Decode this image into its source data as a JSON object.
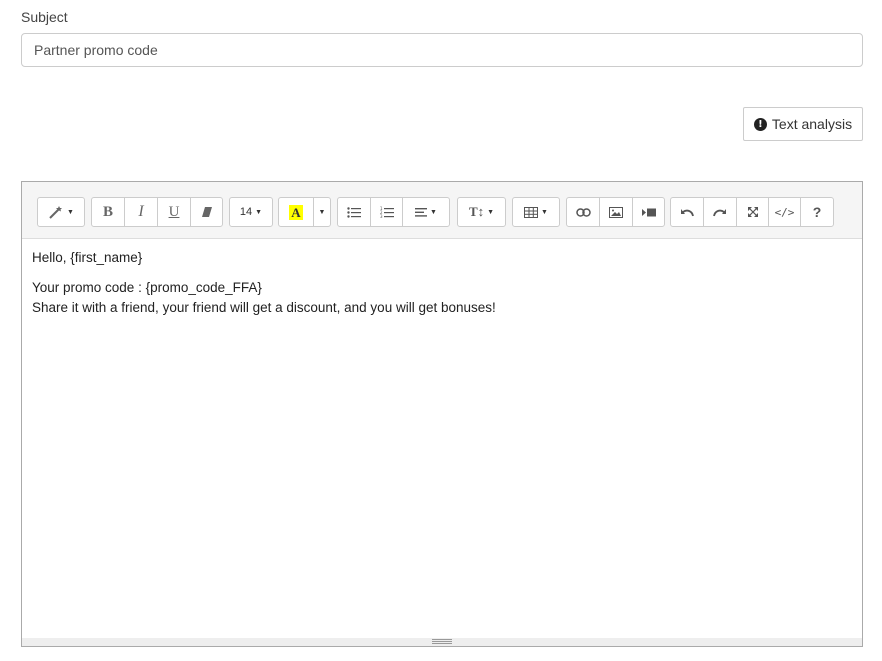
{
  "subject": {
    "label": "Subject",
    "value": "Partner promo code"
  },
  "text_analysis": {
    "label": "Text analysis"
  },
  "toolbar": {
    "font_size": "14"
  },
  "body": {
    "lines": [
      "Hello, {first_name}",
      "",
      "Your promo code : {promo_code_FFA}",
      "Share it with a friend, your friend will get a discount, and you will get bonuses!"
    ]
  },
  "colors": {
    "highlight": "#ffff00",
    "border": "#cccccc",
    "toolbar_bg": "#f5f5f5"
  }
}
